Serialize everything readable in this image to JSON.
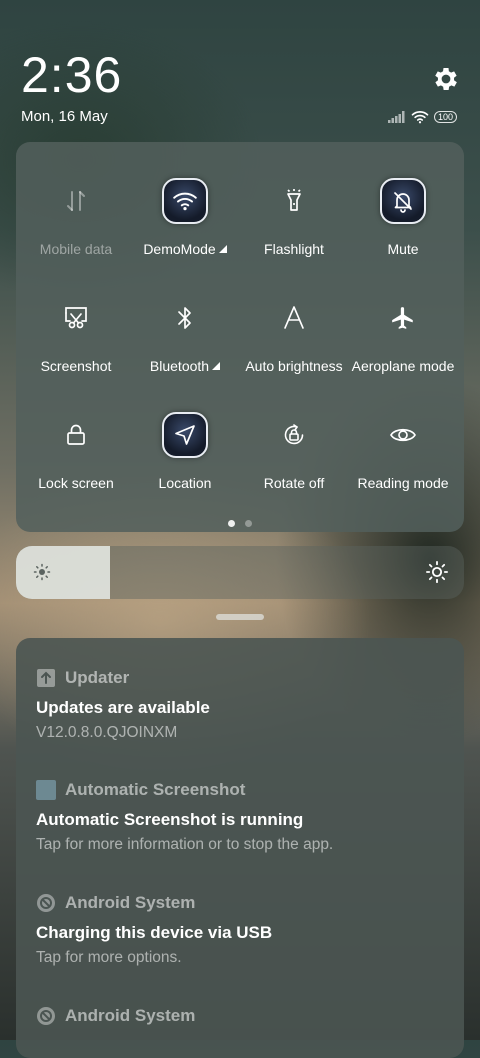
{
  "status": {
    "time": "2:36",
    "date": "Mon, 16 May",
    "battery": "100"
  },
  "quick_settings": {
    "tiles": [
      {
        "label": "Mobile data",
        "icon": "mobile-data-icon",
        "active": false,
        "disabled": true,
        "has_arrow": false
      },
      {
        "label": "DemoMode",
        "icon": "wifi-icon",
        "active": true,
        "disabled": false,
        "has_arrow": true
      },
      {
        "label": "Flashlight",
        "icon": "flashlight-icon",
        "active": false,
        "disabled": false,
        "has_arrow": false
      },
      {
        "label": "Mute",
        "icon": "mute-bell-icon",
        "active": true,
        "disabled": false,
        "has_arrow": false
      },
      {
        "label": "Screenshot",
        "icon": "screenshot-icon",
        "active": false,
        "disabled": false,
        "has_arrow": false
      },
      {
        "label": "Bluetooth",
        "icon": "bluetooth-icon",
        "active": false,
        "disabled": false,
        "has_arrow": true
      },
      {
        "label": "Auto brightness",
        "icon": "auto-brightness-icon",
        "active": false,
        "disabled": false,
        "has_arrow": false
      },
      {
        "label": "Aeroplane mode",
        "icon": "airplane-icon",
        "active": false,
        "disabled": false,
        "has_arrow": false
      },
      {
        "label": "Lock screen",
        "icon": "lock-icon",
        "active": false,
        "disabled": false,
        "has_arrow": false
      },
      {
        "label": "Location",
        "icon": "location-icon",
        "active": true,
        "disabled": false,
        "has_arrow": false
      },
      {
        "label": "Rotate off",
        "icon": "rotate-lock-icon",
        "active": false,
        "disabled": false,
        "has_arrow": false
      },
      {
        "label": "Reading mode",
        "icon": "eye-icon",
        "active": false,
        "disabled": false,
        "has_arrow": false
      }
    ],
    "page_index": 1,
    "page_count": 2
  },
  "brightness": {
    "level": 0.21
  },
  "notifications": [
    {
      "app": "Updater",
      "app_icon": "updater-icon",
      "title": "Updates are available",
      "body": "V12.0.8.0.QJOINXM"
    },
    {
      "app": "Automatic Screenshot",
      "app_icon": "automatic-screenshot-icon",
      "title": "Automatic Screenshot is running",
      "body": "Tap for more information or to stop the app."
    },
    {
      "app": "Android System",
      "app_icon": "android-system-icon",
      "title": "Charging this device via USB",
      "body": "Tap for more options."
    },
    {
      "app": "Android System",
      "app_icon": "android-system-icon",
      "title": "",
      "body": ""
    }
  ]
}
